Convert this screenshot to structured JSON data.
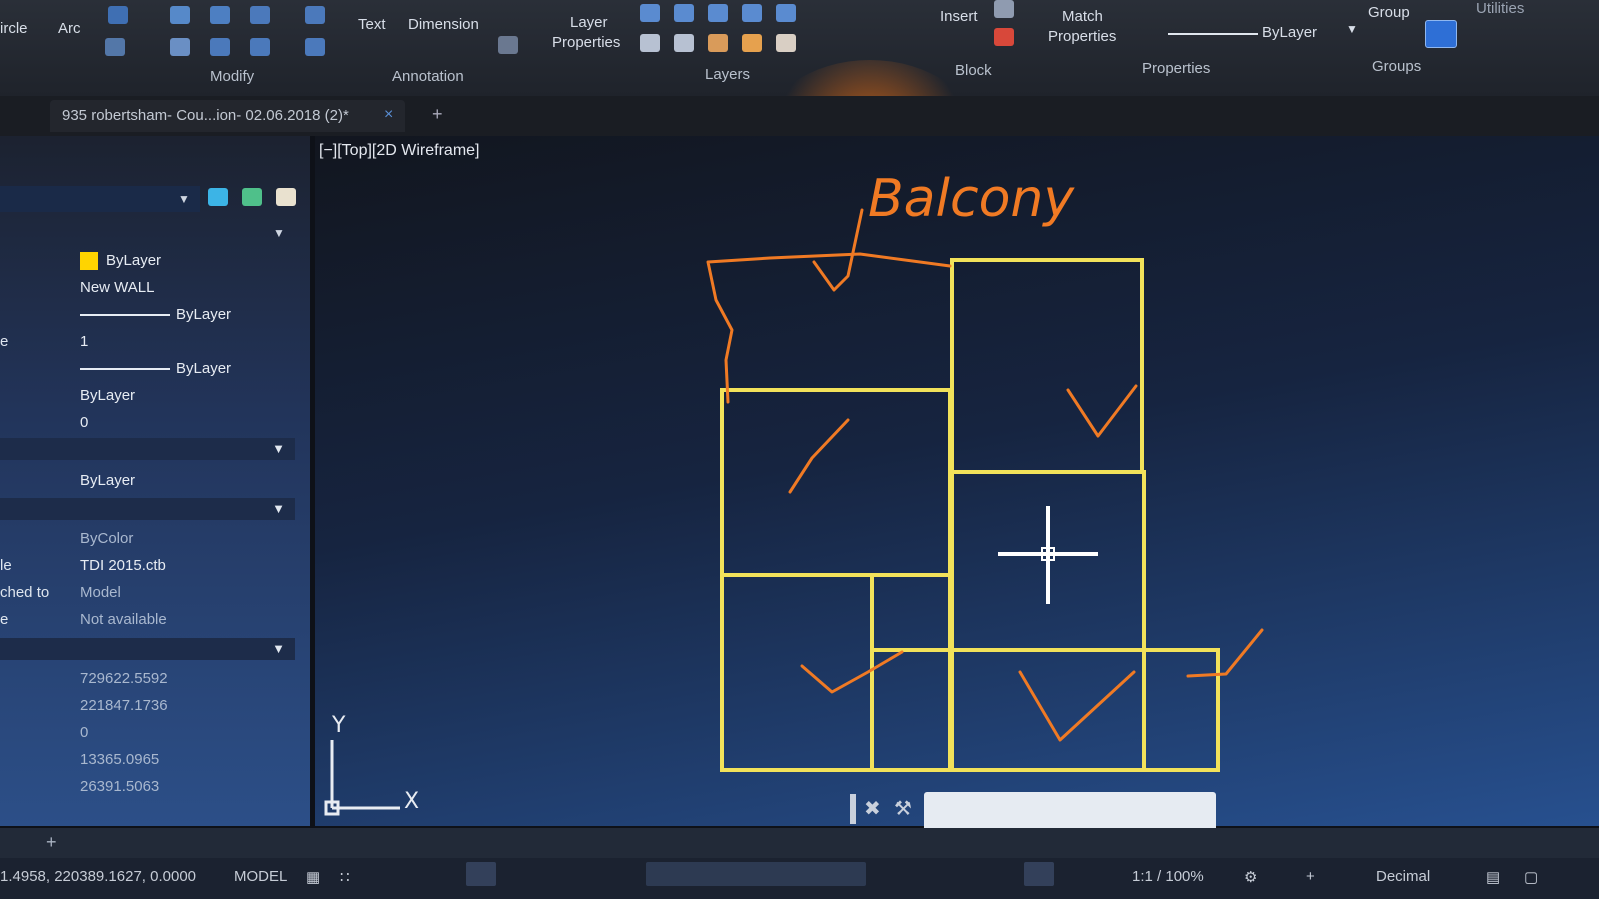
{
  "ribbon": {
    "tools": [
      "ircle",
      "Arc",
      "Text",
      "Dimension",
      "Layer",
      "Properties",
      "Insert",
      "Match",
      "Properties",
      "ByLayer",
      "Group",
      "Utilities"
    ],
    "groups": [
      "Modify",
      "Annotation",
      "Layers",
      "Block",
      "Properties",
      "Groups"
    ],
    "lineweight_value": "ByLayer"
  },
  "tab": {
    "title": "935 robertsham- Cou...ion- 02.06.2018 (2)*",
    "close": "×",
    "add": "+"
  },
  "viewport": {
    "label": "[−][Top][2D Wireframe]",
    "annotation": "Balcony",
    "ucs_y": "Y",
    "ucs_x": "X"
  },
  "properties": {
    "color": "ByLayer",
    "layer": "New WALL",
    "linetype": "ByLayer",
    "linetype_scale": "1",
    "lineweight": "ByLayer",
    "transparency": "ByLayer",
    "thickness": "0",
    "material": "ByLayer",
    "plot_style": "ByColor",
    "plot_style_table": "TDI 2015.ctb",
    "plot_table_attached_to": "Model",
    "plot_table_type": "Not available",
    "center_x": "729622.5592",
    "center_y": "221847.1736",
    "center_z": "0",
    "height": "13365.0965",
    "width": "26391.5063",
    "label_frags": [
      "e",
      "le",
      "ched to",
      "e"
    ]
  },
  "status": {
    "coords": "1.4958, 220389.1627, 0.0000",
    "space": "MODEL",
    "scale": "1:1 / 100%",
    "units": "Decimal"
  },
  "colors": {
    "wall": "#f2e25a",
    "markup": "#f07a24",
    "accent": "#ffd400"
  }
}
